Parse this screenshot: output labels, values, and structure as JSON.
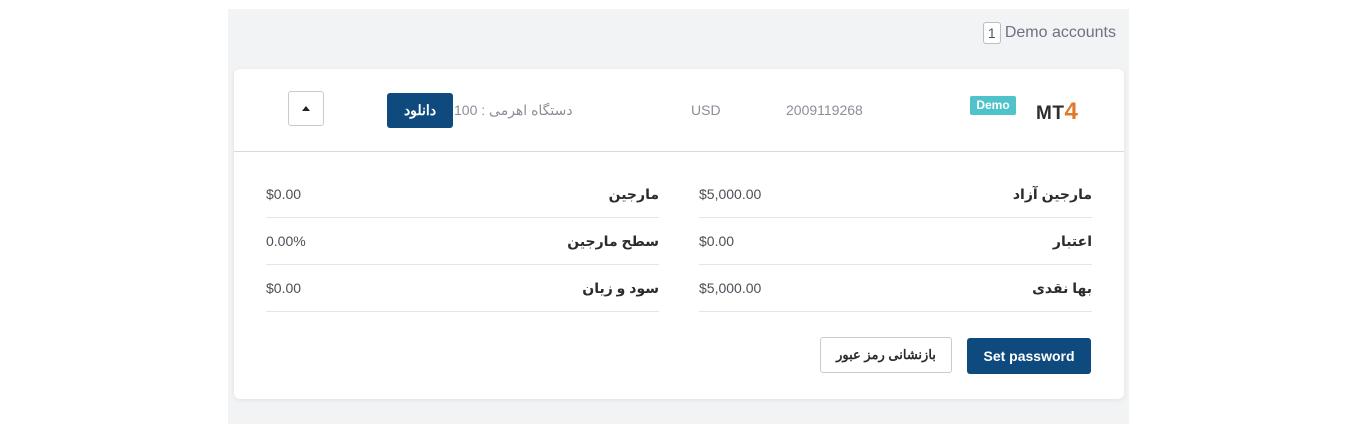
{
  "header": {
    "count": "1",
    "label": "Demo accounts"
  },
  "account": {
    "platform_prefix": "MT",
    "platform_suffix": "4",
    "badge": "Demo",
    "number": "2009119268",
    "currency": "USD",
    "leverage_label": "دستگاه اهرمی : 100",
    "download_label": "دانلود"
  },
  "stats_right": [
    {
      "label": "مارجین آزاد",
      "value": "$5,000.00"
    },
    {
      "label": "اعتبار",
      "value": "$0.00"
    },
    {
      "label": "بها نقدی",
      "value": "$5,000.00"
    }
  ],
  "stats_left": [
    {
      "label": "مارجین",
      "value": "$0.00"
    },
    {
      "label": "سطح مارجین",
      "value": "0.00%"
    },
    {
      "label": "سود و زیان",
      "value": "$0.00"
    }
  ],
  "actions": {
    "set_password": "Set password",
    "reset_password": "بازنشانی رمز عبور"
  },
  "colors": {
    "primary": "#0e4a7e",
    "badge": "#4fc3c9",
    "accent": "#e0782b"
  }
}
